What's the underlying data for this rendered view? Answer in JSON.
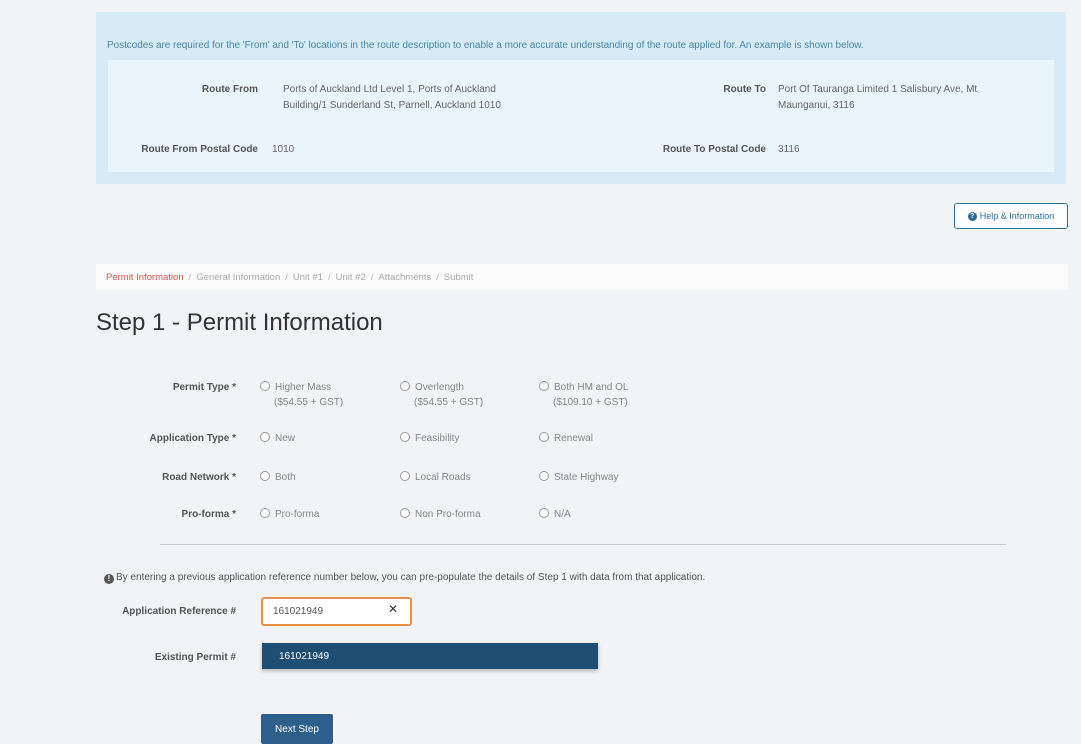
{
  "notice": {
    "text": "Postcodes are required for the 'From' and 'To' locations in the route description to enable a more accurate understanding of the route applied for. An example is shown below.",
    "example": {
      "route_from_label": "Route From",
      "route_from_value_line1": "Ports of Auckland Ltd Level 1, Ports of Auckland",
      "route_from_value_line2": "Building/1 Sunderland St, Parnell, Auckland 1010",
      "route_to_label": "Route To",
      "route_to_value_line1": "Port Of Tauranga Limited 1 Salisbury Ave, Mt",
      "route_to_value_line2": "Maunganui, 3116",
      "from_postal_label": "Route From Postal Code",
      "from_postal_value": "1010",
      "to_postal_label": "Route To Postal Code",
      "to_postal_value": "3116"
    }
  },
  "help_button": {
    "label": "Help & Information",
    "icon": "info-circle-icon"
  },
  "breadcrumb": [
    {
      "label": "Permit Information",
      "active": true
    },
    {
      "label": "General Information",
      "active": false
    },
    {
      "label": "Unit #1",
      "active": false
    },
    {
      "label": "Unit #2",
      "active": false
    },
    {
      "label": "Attachments",
      "active": false
    },
    {
      "label": "Submit",
      "active": false
    }
  ],
  "step_title": "Step 1 - Permit Information",
  "form": {
    "permit_type": {
      "label": "Permit Type *",
      "options": [
        {
          "label": "Higher Mass",
          "sub": "($54.55 + GST)"
        },
        {
          "label": "Overlength",
          "sub": "($54.55 + GST)"
        },
        {
          "label": "Both HM and OL",
          "sub": "($109.10 + GST)"
        }
      ]
    },
    "application_type": {
      "label": "Application Type *",
      "options": [
        {
          "label": "New"
        },
        {
          "label": "Feasibility"
        },
        {
          "label": "Renewal"
        }
      ]
    },
    "road_network": {
      "label": "Road Network *",
      "options": [
        {
          "label": "Both"
        },
        {
          "label": "Local Roads"
        },
        {
          "label": "State Highway"
        }
      ]
    },
    "pro_forma": {
      "label": "Pro-forma *",
      "options": [
        {
          "label": "Pro-forma"
        },
        {
          "label": "Non Pro-forma"
        },
        {
          "label": "N/A"
        }
      ]
    }
  },
  "tip": "By entering a previous application reference number below, you can pre-populate the details of Step 1 with data from that application.",
  "application_reference": {
    "label": "Application Reference #",
    "value": "161021949",
    "suggestion": "161021949"
  },
  "existing_permit": {
    "label": "Existing Permit #"
  },
  "next_button": "Next Step",
  "colors": {
    "accent": "#1f4e75",
    "focus": "#e8904a",
    "notice_bg": "#d6ebf6",
    "active_crumb": "#d9534f"
  }
}
